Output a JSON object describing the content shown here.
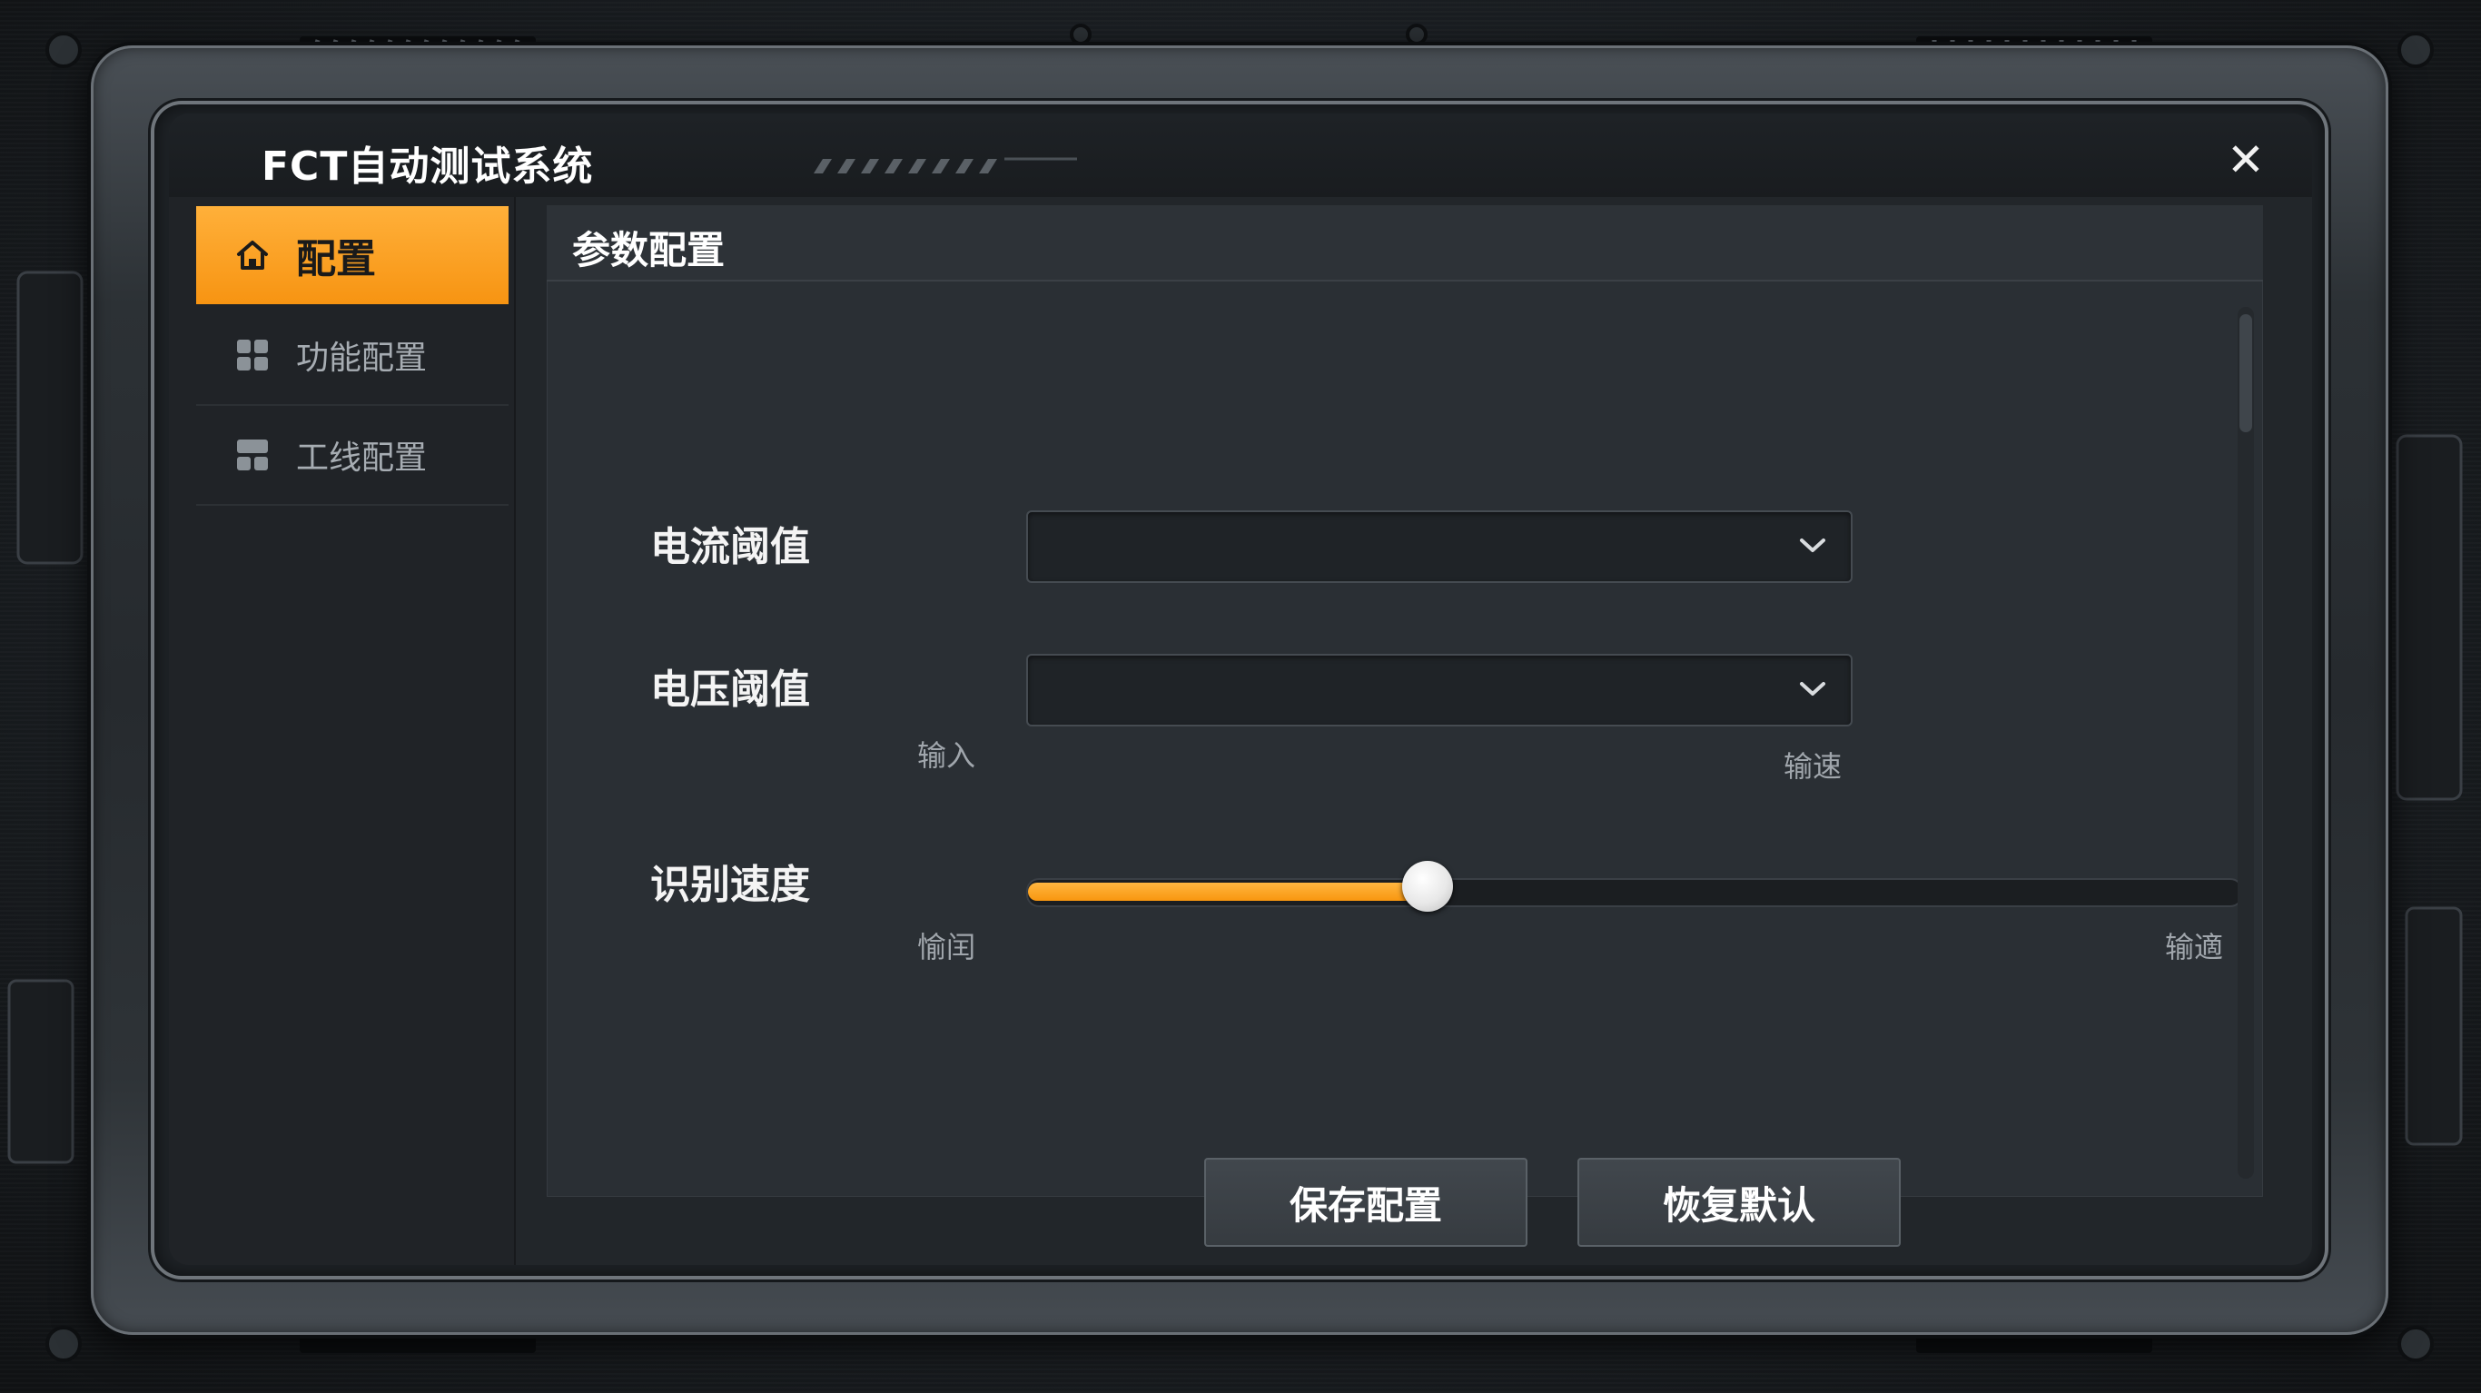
{
  "window": {
    "title": "FCT自动测试系统",
    "close_glyph": "✕"
  },
  "sidebar": {
    "items": [
      {
        "label": "配置",
        "icon": "home-icon",
        "active": true
      },
      {
        "label": "功能配置",
        "icon": "grid-icon",
        "active": false
      },
      {
        "label": "工线配置",
        "icon": "layout-icon",
        "active": false
      }
    ]
  },
  "panel": {
    "title": "参数配置",
    "current_threshold": {
      "label": "电流阈值",
      "value": ""
    },
    "voltage_threshold": {
      "label": "电压阈值",
      "value": "",
      "hint_left": "输入",
      "hint_right": "输速"
    },
    "recognition_speed": {
      "label": "识别速度",
      "value_fraction": 0.33,
      "hint_left": "愉闰",
      "hint_right": "输適"
    },
    "buttons": {
      "save": "保存配置",
      "reset": "恢复默认"
    }
  },
  "colors": {
    "accent": "#f7a21b",
    "panel_bg": "#2a2f34",
    "sidebar_bg": "#202327"
  }
}
